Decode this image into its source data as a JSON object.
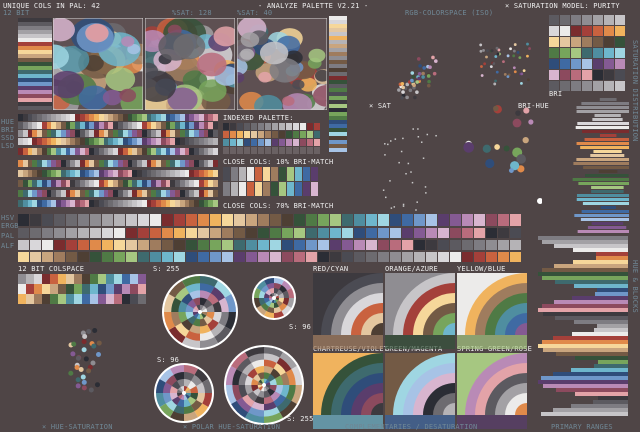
{
  "header": {
    "left": "UNIQUE COLS IN PAL: 42",
    "title": "- ANALYZE PALETTE V2.21 -",
    "right": "× SATURATION MODEL: PURITY",
    "sub_left": "12 BIT",
    "sub_sat128": "%SAT: 128",
    "sub_sat40": "%SAT: 40",
    "sub_rgb": "RGB-COLORSPACE (ISO)"
  },
  "left_labels": {
    "hue": "HUE",
    "bri": "BRI",
    "ssd": "SSD",
    "lsd": "LSD",
    "hsv": "HSV",
    "ergb": "ERGB",
    "pal": "PAL",
    "alf": "ALF"
  },
  "indexed": {
    "title": "INDEXED PALETTE:",
    "close10": "CLOSE COLS: 10% BRI-MATCH",
    "close70": "CLOSE COLS: 70% BRI-MATCH"
  },
  "scatter": {
    "sat_label": "× SAT",
    "bri_hue": "BRI-HUE",
    "bri": "BRI"
  },
  "colspace": {
    "title": "12 BIT COLSPACE"
  },
  "wheels": {
    "s255a": "S: 255",
    "s96a": "S: 96",
    "s96b": "S: 96",
    "s255b": "S: 255"
  },
  "pairs": [
    "RED/CYAN",
    "ORANGE/AZURE",
    "YELLOW/BLUE",
    "CHARTREUSE/VIOLET",
    "GREEN/MAGENTA",
    "SPRING-GREEN/ROSE"
  ],
  "right_side": {
    "sat_distribution": "SATURATION DISTRIBUTION",
    "hue_blocks": "HUE & BLOCKS"
  },
  "footer": {
    "hue_sat": "× HUE-SATURATION",
    "polar": "× POLAR HUE-SATURATION",
    "complementaries": "COMPLEMENTARIES / DESATURATION",
    "primary_ranges": "PRIMARY RANGES"
  },
  "palette": [
    "#2b2d35",
    "#3d3a3f",
    "#4b4b53",
    "#5c5a60",
    "#6d6b70",
    "#7e7c82",
    "#8f8d92",
    "#a3a1a5",
    "#b5b3b6",
    "#c7c5c8",
    "#d9d7da",
    "#ecebea",
    "#7a2c2e",
    "#a4403a",
    "#c9623f",
    "#e08a4a",
    "#f0b35e",
    "#f6d79a",
    "#e4c7a0",
    "#c9a57e",
    "#9f7c5e",
    "#735a45",
    "#4e3f34",
    "#35523a",
    "#4f7a45",
    "#77a55c",
    "#a6c781",
    "#3e6a6e",
    "#4f8ea0",
    "#6eb6cc",
    "#9fd6e2",
    "#2f4d7a",
    "#3f6aa3",
    "#6f97c9",
    "#a7c3e6",
    "#5a3d6c",
    "#845a93",
    "#b98ab6",
    "#d8b5cf",
    "#8c4a5e",
    "#b96c7c",
    "#e3a3a8"
  ]
}
